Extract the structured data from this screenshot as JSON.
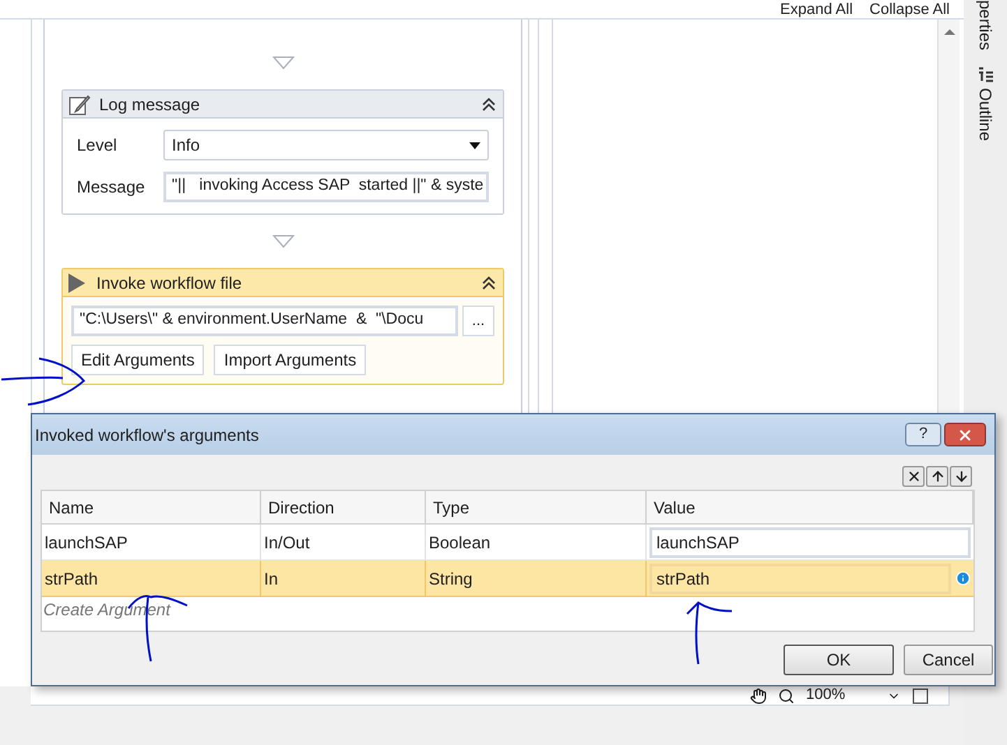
{
  "toolbar": {
    "expand_all": "Expand All",
    "collapse_all": "Collapse All"
  },
  "side_tabs": [
    {
      "label": "perties",
      "kind": "text"
    },
    {
      "label": "Outline",
      "kind": "outline"
    }
  ],
  "log_message": {
    "title": "Log message",
    "level_label": "Level",
    "level_value": "Info",
    "message_label": "Message",
    "message_value": "\"||   invoking Access SAP  started ||\" & syste"
  },
  "invoke_workflow": {
    "title": "Invoke workflow file",
    "path": "\"C:\\Users\\\" & environment.UserName  &  \"\\Docu",
    "browse": "...",
    "buttons": [
      "Edit Arguments",
      "Import Arguments"
    ]
  },
  "zoom": "100%",
  "dialog": {
    "title": "Invoked workflow's arguments",
    "help": "?",
    "columns": [
      "Name",
      "Direction",
      "Type",
      "Value"
    ],
    "rows": [
      {
        "cells": [
          "launchSAP",
          "In/Out",
          "Boolean",
          "launchSAP"
        ],
        "selected": false,
        "warning": false
      },
      {
        "cells": [
          "strPath",
          "In",
          "String",
          "strPath"
        ],
        "selected": true,
        "warning": true
      }
    ],
    "create_placeholder": "Create Argument",
    "buttons": [
      "OK",
      "Cancel"
    ]
  }
}
